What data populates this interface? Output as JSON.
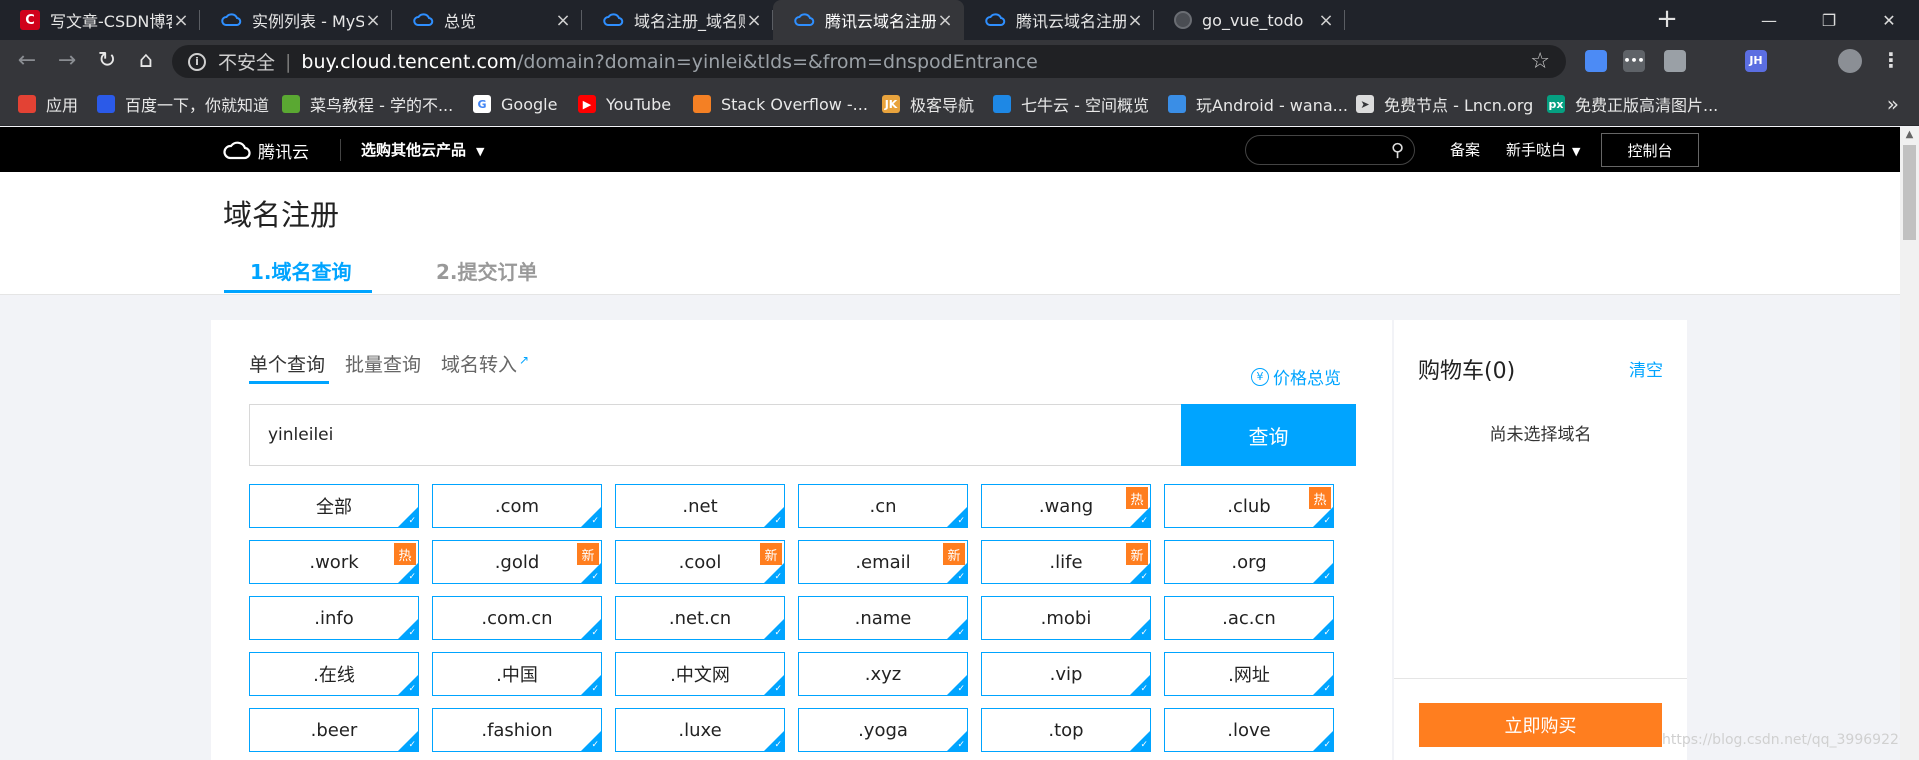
{
  "browser": {
    "tabs": [
      {
        "title": "写文章-CSDN博客",
        "favicon": "csdn-icon"
      },
      {
        "title": "实例列表 - MySQL - 云",
        "favicon": "tencent-cloud-icon"
      },
      {
        "title": "总览",
        "favicon": "tencent-cloud-icon"
      },
      {
        "title": "域名注册_域名购买、申",
        "favicon": "tencent-cloud-icon"
      },
      {
        "title": "腾讯云域名注册 - 值得",
        "favicon": "tencent-cloud-icon",
        "active": true
      },
      {
        "title": "腾讯云域名注册 - 值得",
        "favicon": "tencent-cloud-icon"
      },
      {
        "title": "go_vue_todo",
        "favicon": "globe-icon"
      }
    ],
    "address": {
      "security_label": "不安全",
      "host": "buy.cloud.tencent.com",
      "path": "/domain?domain=yinlei&tlds=&from=dnspodEntrance"
    },
    "bookmarks": [
      {
        "label": "应用",
        "icon": "apps-grid-icon"
      },
      {
        "label": "百度一下，你就知道",
        "icon": "baidu-icon"
      },
      {
        "label": "菜鸟教程 - 学的不...",
        "icon": "runoob-icon"
      },
      {
        "label": "Google",
        "icon": "google-icon"
      },
      {
        "label": "YouTube",
        "icon": "youtube-icon"
      },
      {
        "label": "Stack Overflow -...",
        "icon": "stackoverflow-icon"
      },
      {
        "label": "极客导航",
        "icon": "jike-icon"
      },
      {
        "label": "七牛云 - 空间概览",
        "icon": "qiniu-icon"
      },
      {
        "label": "玩Android - wana...",
        "icon": "wanandroid-icon"
      },
      {
        "label": "免费节点 - Lncn.org",
        "icon": "paper-plane-icon"
      },
      {
        "label": "免费正版高清图片...",
        "icon": "pexels-icon"
      }
    ],
    "extensions": [
      {
        "label": "",
        "icon": "colorful-extension-icon",
        "color": "#4c8bf5"
      },
      {
        "label": "•••",
        "icon": "dots-extension-icon",
        "color": "#5f6368"
      },
      {
        "label": "",
        "icon": "vue-devtools-icon",
        "color": "#9aa0a6"
      },
      {
        "label": "",
        "icon": "react-devtools-icon",
        "color": "#35363a"
      },
      {
        "label": "JH",
        "icon": "jsonhandle-icon",
        "color": "#5b6ee1"
      },
      {
        "label": "",
        "icon": "target-extension-icon",
        "color": "#35363a"
      }
    ]
  },
  "tencent_nav": {
    "brand": "腾讯云",
    "products_label": "选购其他云产品",
    "beian_label": "备案",
    "newbie_label": "新手哒白",
    "console_label": "控制台"
  },
  "page": {
    "title": "域名注册",
    "steps": [
      "1.域名查询",
      "2.提交订单"
    ]
  },
  "query": {
    "tabs": [
      "单个查询",
      "批量查询",
      "域名转入"
    ],
    "price_overview": "价格总览",
    "search_value": "yinleilei",
    "search_button": "查询",
    "tlds": [
      {
        "label": "全部",
        "badge": ""
      },
      {
        "label": ".com",
        "badge": ""
      },
      {
        "label": ".net",
        "badge": ""
      },
      {
        "label": ".cn",
        "badge": ""
      },
      {
        "label": ".wang",
        "badge": "热"
      },
      {
        "label": ".club",
        "badge": "热"
      },
      {
        "label": ".work",
        "badge": "热"
      },
      {
        "label": ".gold",
        "badge": "新"
      },
      {
        "label": ".cool",
        "badge": "新"
      },
      {
        "label": ".email",
        "badge": "新"
      },
      {
        "label": ".life",
        "badge": "新"
      },
      {
        "label": ".org",
        "badge": ""
      },
      {
        "label": ".info",
        "badge": ""
      },
      {
        "label": ".com.cn",
        "badge": ""
      },
      {
        "label": ".net.cn",
        "badge": ""
      },
      {
        "label": ".name",
        "badge": ""
      },
      {
        "label": ".mobi",
        "badge": ""
      },
      {
        "label": ".ac.cn",
        "badge": ""
      },
      {
        "label": ".在线",
        "badge": ""
      },
      {
        "label": ".中国",
        "badge": ""
      },
      {
        "label": ".中文网",
        "badge": ""
      },
      {
        "label": ".xyz",
        "badge": ""
      },
      {
        "label": ".vip",
        "badge": ""
      },
      {
        "label": ".网址",
        "badge": ""
      },
      {
        "label": ".beer",
        "badge": ""
      },
      {
        "label": ".fashion",
        "badge": ""
      },
      {
        "label": ".luxe",
        "badge": ""
      },
      {
        "label": ".yoga",
        "badge": ""
      },
      {
        "label": ".top",
        "badge": ""
      },
      {
        "label": ".love",
        "badge": ""
      }
    ]
  },
  "cart": {
    "title": "购物车(0)",
    "clear_label": "清空",
    "empty_text": "尚未选择域名",
    "buy_button": "立即购买"
  },
  "watermark": "https://blog.csdn.net/qq_39969226",
  "colors": {
    "accent": "#00a4ff",
    "badge": "#ff7e1f",
    "buy": "#ff7e1f"
  }
}
